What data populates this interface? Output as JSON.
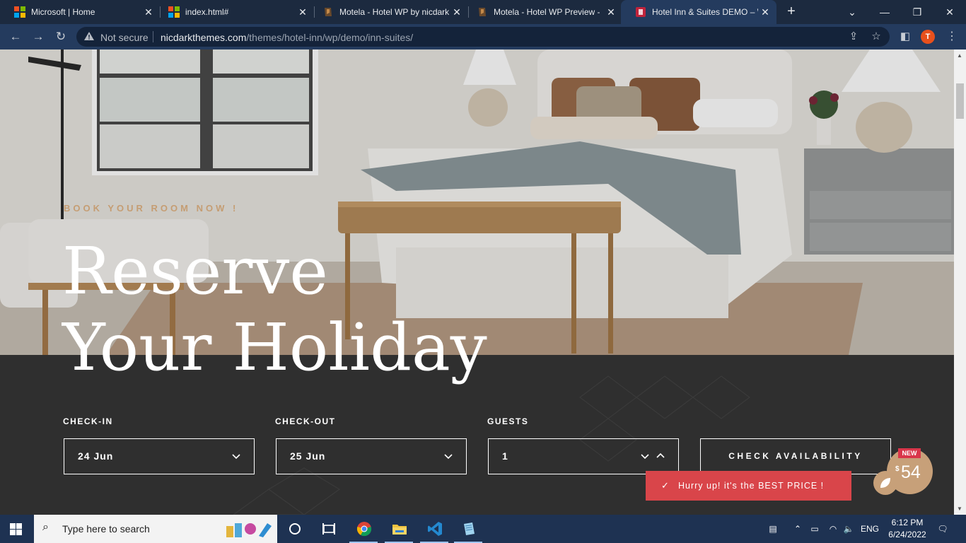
{
  "browser": {
    "tabs": [
      {
        "title": "Microsoft | Home",
        "favicon": "microsoft-logo",
        "active": false
      },
      {
        "title": "index.html#",
        "favicon": "microsoft-logo",
        "active": false
      },
      {
        "title": "Motela - Hotel WP by nicdark",
        "favicon": "nicdark-logo",
        "active": false
      },
      {
        "title": "Motela - Hotel WP Preview - ",
        "favicon": "nicdark-logo",
        "active": false
      },
      {
        "title": "Hotel Inn & Suites DEMO – W",
        "favicon": "hotel-logo",
        "active": true
      }
    ],
    "address": {
      "security_label": "Not secure",
      "host": "nicdarkthemes.com",
      "path": "/themes/hotel-inn/wp/demo/inn-suites/"
    },
    "profile_initial": "T"
  },
  "page": {
    "eyebrow": "BOOK YOUR ROOM NOW !",
    "headline_line1": "Reserve",
    "headline_line2": "Your Holiday",
    "booking": {
      "checkin_label": "CHECK-IN",
      "checkin_value": "24 Jun",
      "checkout_label": "CHECK-OUT",
      "checkout_value": "25 Jun",
      "guests_label": "GUESTS",
      "guests_value": "1",
      "submit_label": "CHECK AVAILABILITY"
    },
    "toast": {
      "message": "Hurry up! it's the BEST PRICE !"
    },
    "price_badge": {
      "new_label": "NEW",
      "currency": "$",
      "price": "54"
    }
  },
  "taskbar": {
    "search_placeholder": "Type here to search",
    "language": "ENG",
    "time": "6:12 PM",
    "date": "6/24/2022"
  },
  "colors": {
    "accent_gold": "#c59d73",
    "toast_red": "#d9454a",
    "band_dark": "#2f2f2f",
    "chrome_dark": "#1c2a3f"
  }
}
